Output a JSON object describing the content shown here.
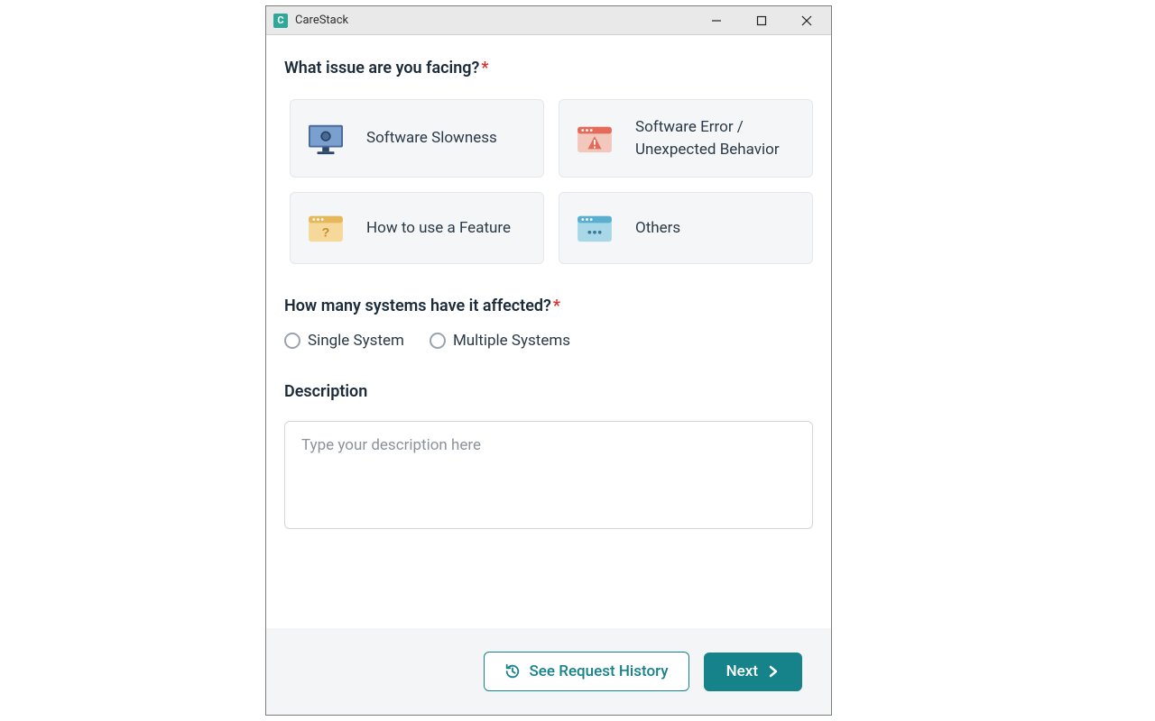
{
  "window": {
    "app_name": "CareStack",
    "logo_letter": "C"
  },
  "q1": {
    "label": "What issue are you facing?",
    "options": [
      {
        "label": "Software Slowness",
        "icon": "monitor"
      },
      {
        "label": "Software Error / Unexpected Behavior",
        "icon": "alert"
      },
      {
        "label": "How to use a Feature",
        "icon": "help"
      },
      {
        "label": "Others",
        "icon": "dots"
      }
    ]
  },
  "q2": {
    "label": "How many systems have it affected?",
    "options": [
      "Single System",
      "Multiple Systems"
    ]
  },
  "q3": {
    "label": "Description",
    "placeholder": "Type your description here"
  },
  "footer": {
    "history_label": "See Request History",
    "next_label": "Next"
  }
}
